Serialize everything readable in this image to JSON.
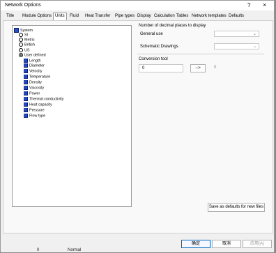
{
  "window": {
    "title": "Network Options",
    "help_glyph": "?",
    "close_glyph": "×"
  },
  "tabs": [
    {
      "label": "Title"
    },
    {
      "label": "Module Options"
    },
    {
      "label": "Units",
      "active": true
    },
    {
      "label": "Fluid"
    },
    {
      "label": "Heat Transfer"
    },
    {
      "label": "Pipe types"
    },
    {
      "label": "Display"
    },
    {
      "label": "Calculation"
    },
    {
      "label": "Tables"
    },
    {
      "label": "Network templates"
    },
    {
      "label": "Defaults"
    }
  ],
  "tree": {
    "root": "System",
    "systems": [
      {
        "label": "SI",
        "selected": false
      },
      {
        "label": "Metric",
        "selected": false
      },
      {
        "label": "British",
        "selected": false
      },
      {
        "label": "US",
        "selected": false
      },
      {
        "label": "User defined",
        "selected": true
      }
    ],
    "units": [
      "Length",
      "Diameter",
      "Velocity",
      "Temperature",
      "Density",
      "Viscosity",
      "Power",
      "Thermal conductivity",
      "Heat capacity",
      "Pressure",
      "Flow type"
    ]
  },
  "decimal_places": {
    "heading": "Number of decimal places to display",
    "general_use_label": "General use",
    "general_use_value": "",
    "schematic_label": "Schematic Drawings",
    "schematic_value": ""
  },
  "conversion_tool": {
    "heading": "Conversion tool",
    "input_value": "0",
    "convert_button": "-->",
    "result": "0"
  },
  "buttons": {
    "save_defaults": "Save as defaults for new files",
    "ok": "确定",
    "cancel": "取消",
    "apply": "应用(A)"
  },
  "background": {
    "left_text": "0",
    "mid_text": "Normal"
  }
}
